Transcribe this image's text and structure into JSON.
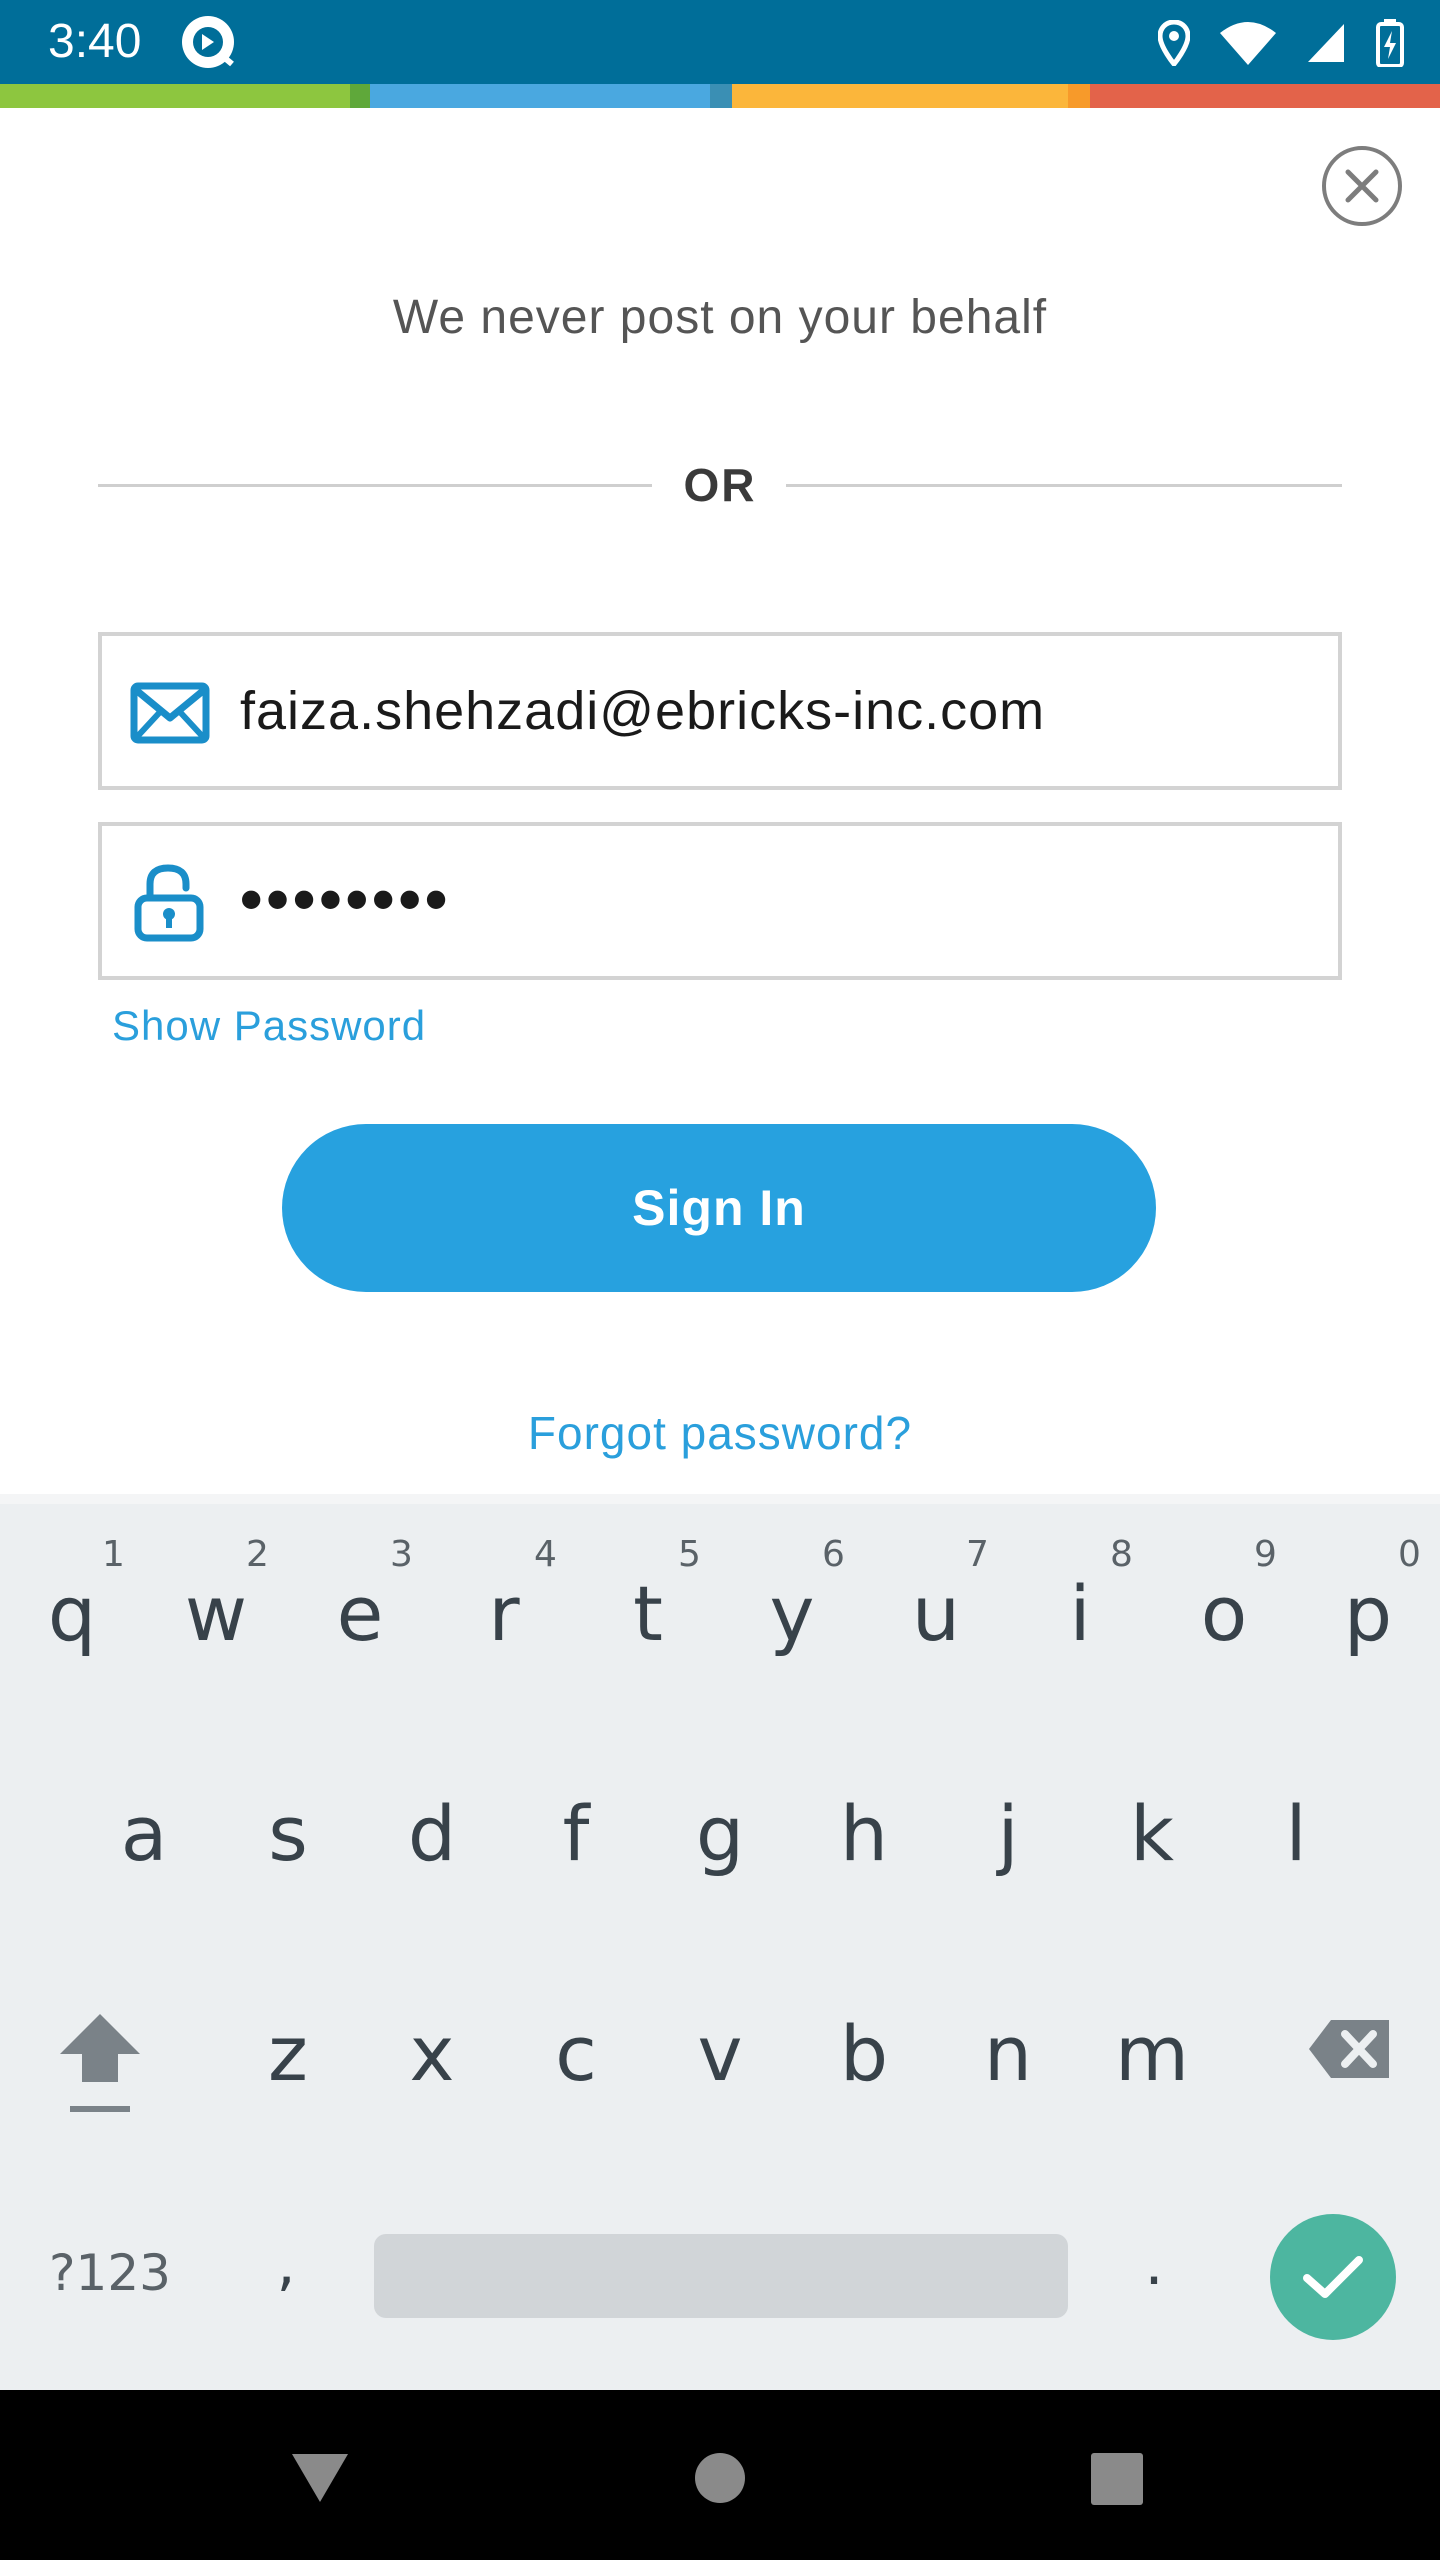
{
  "status_bar": {
    "time": "3:40",
    "background_color": "#006e99",
    "icons": [
      "app-icon",
      "location-icon",
      "wifi-icon",
      "signal-icon",
      "battery-charging-icon"
    ]
  },
  "stripe_colors": [
    "#8dc63f",
    "#4aa8e0",
    "#fbb63b",
    "#e3634a"
  ],
  "dialog": {
    "close_icon": "close-icon",
    "tagline": "We never post on your behalf",
    "divider_text": "OR",
    "email_field": {
      "icon": "mail-icon",
      "value": "faiza.shehzadi@ebricks-inc.com"
    },
    "password_field": {
      "icon": "lock-icon",
      "value": "••••••••"
    },
    "show_password_label": "Show Password",
    "sign_in_label": "Sign In",
    "forgot_password_label": "Forgot password?",
    "accent_color": "#27a1df"
  },
  "keyboard": {
    "row1": [
      {
        "letter": "q",
        "hint": "1"
      },
      {
        "letter": "w",
        "hint": "2"
      },
      {
        "letter": "e",
        "hint": "3"
      },
      {
        "letter": "r",
        "hint": "4"
      },
      {
        "letter": "t",
        "hint": "5"
      },
      {
        "letter": "y",
        "hint": "6"
      },
      {
        "letter": "u",
        "hint": "7"
      },
      {
        "letter": "i",
        "hint": "8"
      },
      {
        "letter": "o",
        "hint": "9"
      },
      {
        "letter": "p",
        "hint": "0"
      }
    ],
    "row2": [
      "a",
      "s",
      "d",
      "f",
      "g",
      "h",
      "j",
      "k",
      "l"
    ],
    "row3": [
      "z",
      "x",
      "c",
      "v",
      "b",
      "n",
      "m"
    ],
    "symbols_label": "?123",
    "comma_label": ",",
    "period_label": ".",
    "shift_icon": "shift-icon",
    "backspace_icon": "backspace-icon",
    "enter_icon": "checkmark-icon",
    "enter_color": "#4db6a0"
  },
  "nav_bar": {
    "back_icon": "back-triangle-icon",
    "home_icon": "home-circle-icon",
    "recents_icon": "recents-square-icon"
  }
}
